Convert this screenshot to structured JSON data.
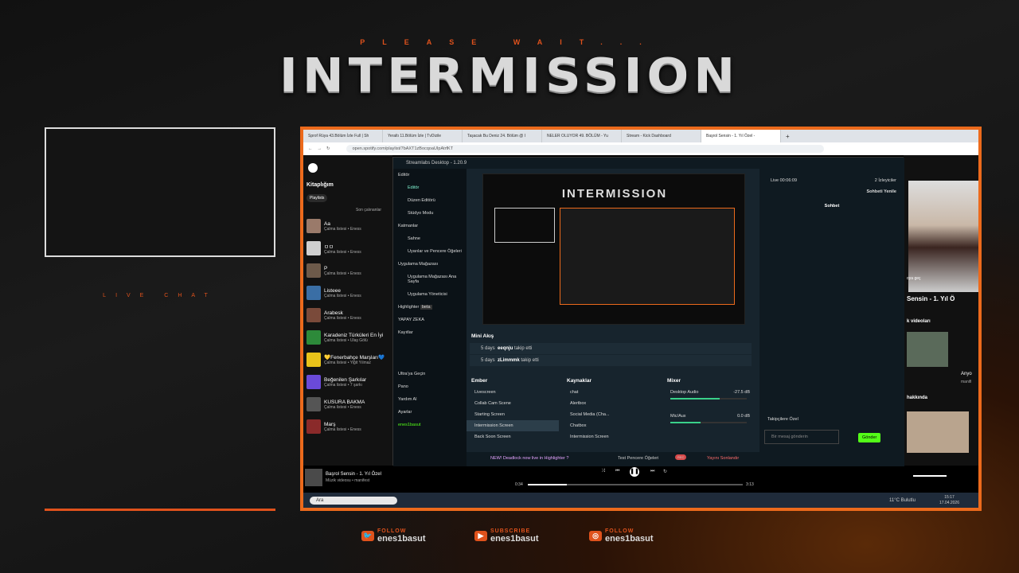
{
  "overlay": {
    "please_wait": "PLEASE WAIT...",
    "title": "INTERMISSION",
    "live_chat": "LIVE CHAT"
  },
  "browser": {
    "tabs": [
      "Sprof Rüya 43.Bölüm İzle Full | Sh",
      "Yeraltı 11.Bölüm İzle | TvDizile",
      "Taşacak Bu Deniz 24. Bölüm @ I",
      "NELER OLUYOR 49. BÖLÜM - Yu",
      "Stream - Kick Dashboard",
      "Başrol Sensin - 1. Yıl Özel -"
    ],
    "url": "open.spotify.com/playlist/7bAXT1zBocqoaUIpAtrfKT"
  },
  "spotify": {
    "library": "Kitaplığım",
    "filter": "Playlists",
    "sort": "Son çalınanlar",
    "playlists": [
      {
        "name": "Aa",
        "meta": "Çalma listesi • Eness",
        "color": "#9a7a6a"
      },
      {
        "name": "ㅁㅁ",
        "meta": "Çalma listesi • Eness",
        "color": "#cfcfcf"
      },
      {
        "name": "P",
        "meta": "Çalma listesi • Eness",
        "color": "#6d5a4a"
      },
      {
        "name": "Listeee",
        "meta": "Çalma listesi • Eness",
        "color": "#3a6ea5"
      },
      {
        "name": "Arabesk",
        "meta": "Çalma listesi • Eness",
        "color": "#7a4a3a"
      },
      {
        "name": "Karadeniz Türküleri En İyi",
        "meta": "Çalma listesi • Ulaş Gölü",
        "color": "#2d8a3a"
      },
      {
        "name": "💛Fenerbahçe Marşları💙",
        "meta": "Çalma listesi • Yiğit Yılmaz",
        "color": "#e8c21a"
      },
      {
        "name": "Beğenilen Şarkılar",
        "meta": "Çalma listesi • 7 şarkı",
        "color": "#6a4ad8"
      },
      {
        "name": "KUSURA BAKMA",
        "meta": "Çalma listesi • Eness",
        "color": "#555"
      },
      {
        "name": "Marş",
        "meta": "Çalma listesi • Eness",
        "color": "#8a2a2a"
      }
    ],
    "now_playing": {
      "title": "Başrol Sensin - 1. Yıl Özel",
      "artist": "Müzik videosu • manifest",
      "elapsed": "0:34",
      "duration": "3:13",
      "progress": 0.18
    },
    "right_title": "Sensin - 1. Yıl Ö",
    "right_section": "k videoları",
    "right_label": "Anyo",
    "right_sub": "manifi",
    "right_item": "hakkında",
    "right_small": "oya geç"
  },
  "streamlabs": {
    "window_title": "Streamlabs Desktop - 1.20.9",
    "nav": {
      "editor_group": "Editör",
      "editor": "Editör",
      "layout": "Düzen Editörü",
      "studio": "Stüdyo Modu",
      "layers": "Katmanlar",
      "scene": "Sahne",
      "widgets": "Uyarılar ve Pencere Öğeleri",
      "store": "Uygulama Mağazası",
      "store_page": "Uygulama Mağazası Ana Sayfa",
      "app_mgr": "Uygulama Yöneticisi",
      "highlighter": "Highlighter",
      "beta": "beta",
      "ai": "YAPAY ZEKA",
      "recordings": "Kayıtlar",
      "ultra": "Ultra'ya Geçin",
      "dashboard": "Pano",
      "help": "Yardım Al",
      "settings": "Ayarlar",
      "user": "enes1basut"
    },
    "mini_feed": {
      "title": "Mini Akış",
      "rows": [
        {
          "time": "5 days",
          "user": "eeqnju",
          "action": "takip etti"
        },
        {
          "time": "5 days",
          "user": "zLimmmk",
          "action": "takip etti"
        }
      ]
    },
    "scenes": {
      "title": "Ember",
      "items": [
        "Livescreen",
        "Collab Cam Scene",
        "Starting Screen",
        "Intermission Screen",
        "Back Soon Screen"
      ],
      "selected": 3
    },
    "sources": {
      "title": "Kaynaklar",
      "items": [
        "chat",
        "Alertbox",
        "Social Media (Cha...",
        "Chatbox",
        "Intermission Screen"
      ]
    },
    "mixer": {
      "title": "Mixer",
      "ch1": "Desktop Audio",
      "ch1_db": "-27.5 dB",
      "ch1_level": 0.65,
      "ch2": "Mic/Aux",
      "ch2_db": "0.0 dB",
      "ch2_level": 0.4
    },
    "bottom": {
      "news": "NEW! Deadlock now live in Highlighter ?",
      "test": "Test Pencere Öğeleri",
      "rec": "REC",
      "go_live": "Yayını Sonlandır"
    },
    "chat": {
      "live": "Live 00:06:09",
      "viewers": "2 İzleyiciler",
      "refresh": "Sohbeti Yenile",
      "tab": "Sohbet",
      "followers": "Takipçilere Özel",
      "placeholder": "Bir mesaj gönderin",
      "send": "Gönder"
    }
  },
  "taskbar": {
    "search": "Ara",
    "weather": "11°C Bulutlu",
    "time": "15:17",
    "date": "17.04.2026"
  },
  "social": [
    {
      "label": "FOLLOW",
      "handle": "enes1basut",
      "icon": "twitter-icon",
      "color": "#e0521c",
      "glyph": "🐦"
    },
    {
      "label": "SUBSCRIBE",
      "handle": "enes1basut",
      "icon": "youtube-icon",
      "color": "#e0521c",
      "glyph": "▶"
    },
    {
      "label": "FOLLOW",
      "handle": "enes1basut",
      "icon": "instagram-icon",
      "color": "#e0521c",
      "glyph": "◎"
    }
  ],
  "colors": {
    "accent": "#ec6a1c",
    "spotify_green": "#1ed760",
    "kick_green": "#53fc18"
  }
}
